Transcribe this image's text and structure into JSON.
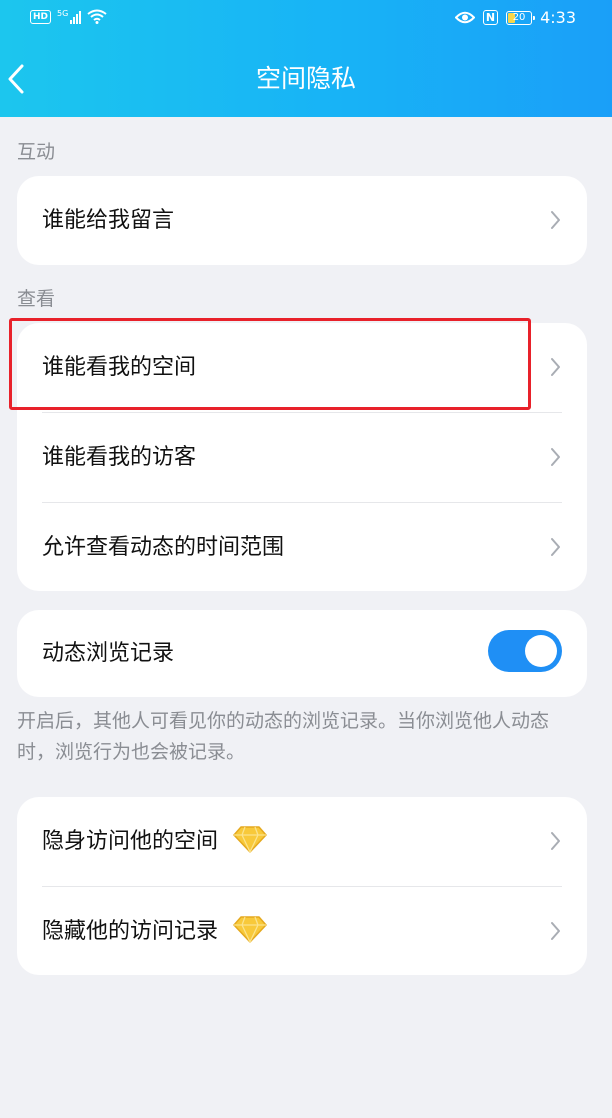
{
  "status_bar": {
    "hd": "HD",
    "network": "5G",
    "nfc": "N",
    "battery": "20",
    "time": "4:33"
  },
  "header": {
    "title": "空间隐私"
  },
  "sections": {
    "interaction_label": "互动",
    "view_label": "查看"
  },
  "interaction_items": [
    {
      "label": "谁能给我留言"
    }
  ],
  "view_items": [
    {
      "label": "谁能看我的空间"
    },
    {
      "label": "谁能看我的访客"
    },
    {
      "label": "允许查看动态的时间范围"
    }
  ],
  "browse_record": {
    "label": "动态浏览记录",
    "enabled": true,
    "description": "开启后，其他人可看见你的动态的浏览记录。当你浏览他人动态时，浏览行为也会被记录。"
  },
  "vip_items": [
    {
      "label": "隐身访问他的空间",
      "icon": "diamond-icon"
    },
    {
      "label": "隐藏他的访问记录",
      "icon": "diamond-icon"
    }
  ],
  "colors": {
    "header_gradient_start": "#1cc6ee",
    "header_gradient_end": "#1a9ff8",
    "toggle_on": "#1f8ff5",
    "highlight_border": "#e8212a",
    "page_background": "#f0f1f5",
    "diamond": "#f8c93a"
  }
}
